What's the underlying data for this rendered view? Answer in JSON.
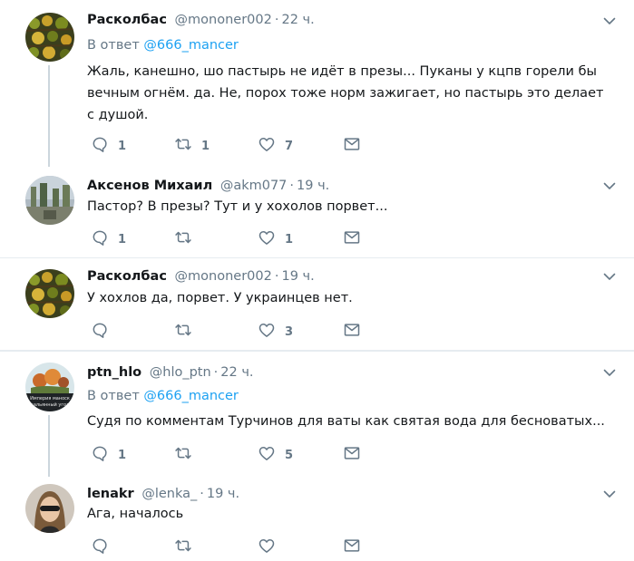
{
  "tweets": [
    {
      "name": "Расколбас",
      "handle": "@mononer002",
      "time": "22 ч.",
      "reply_prefix": "В ответ",
      "reply_to": "@666_mancer",
      "text": "Жаль, канешно, шо пастырь не идёт в презы... Пуканы у кцпв горели бы вечным огнём. да. Не, порох тоже норм зажигает,  но пастырь это делает с душой.",
      "replies": "1",
      "retweets": "1",
      "likes": "7"
    },
    {
      "name": "Аксенов Михаил",
      "handle": "@akm077",
      "time": "19 ч.",
      "text": "Пастор? В презы? Тут и у хохолов порвет...",
      "replies": "1",
      "retweets": "",
      "likes": "1"
    },
    {
      "name": "Расколбас",
      "handle": "@mononer002",
      "time": "19 ч.",
      "text": "У хохлов да, порвет. У украинцев нет.",
      "replies": "",
      "retweets": "",
      "likes": "3"
    },
    {
      "name": "ptn_hlo",
      "handle": "@hlo_ptn",
      "time": "22 ч.",
      "reply_prefix": "В ответ",
      "reply_to": "@666_mancer",
      "text": "Судя по комментам Турчинов для ваты как святая вода для бесноватых...",
      "replies": "1",
      "retweets": "",
      "likes": "5",
      "avatar_caption": "Империя маноск... кальянный угол"
    },
    {
      "name": "lenakr",
      "handle": "@lenka_",
      "time": "19 ч.",
      "text": "Ага, началось",
      "replies": "",
      "retweets": "",
      "likes": ""
    }
  ],
  "icons": {
    "reply": "reply-icon",
    "retweet": "retweet-icon",
    "like": "heart-icon",
    "dm": "envelope-icon",
    "more": "chevron-down-icon"
  },
  "colors": {
    "text": "#14171a",
    "muted": "#657786",
    "link": "#1da1f2",
    "thread_line": "#ccd6dd",
    "separator": "#e6ecf0"
  }
}
